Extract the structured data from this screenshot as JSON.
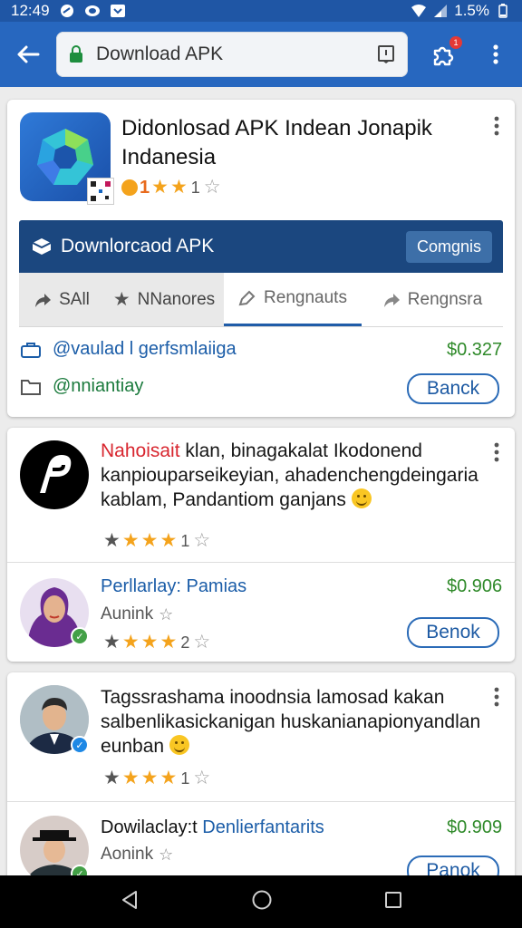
{
  "status_bar": {
    "time": "12:49",
    "battery": "1.5%"
  },
  "toolbar": {
    "url_text": "Download APK",
    "extension_badge": "1"
  },
  "app_card": {
    "title": "Didonlosad APK Indean Jonapik Indanesia",
    "rating_prefix": "1",
    "rating_count": "1",
    "download_banner": {
      "label": "Downlorcaod APK",
      "chip": "Comgnis"
    },
    "tabs": [
      {
        "label": "SAll"
      },
      {
        "label": "NNanores"
      },
      {
        "label": "Rengnauts"
      },
      {
        "label": "Rengnsra"
      }
    ],
    "links": [
      {
        "text": "@vaulad l gerfsmlaiiga",
        "price": "$0.327"
      },
      {
        "text": "@nniantiay",
        "button": "Banck"
      }
    ]
  },
  "posts": [
    {
      "highlight": "Nahoisait",
      "text": " klan, binagakalat Ikodonend kanpiouparseikeyian, ahadenchengdeingaria kablam, Pandantiom ganjans",
      "rating_count": "1",
      "review": {
        "name": "Perllarlay: Pamias",
        "price": "$0.906",
        "sub": "Aunink",
        "rating_count": "2",
        "button": "Benok"
      }
    },
    {
      "text": "Tagssrashama inoodnsia lamosad kakan salbenlikasickanigan huskanianapionyandlan eunban",
      "rating_count": "1",
      "review": {
        "name": "Dowilaclay:t",
        "tag": "Denlierfantarits",
        "price": "$0.909",
        "sub": "Aonink",
        "button": "Panok"
      }
    }
  ],
  "colors": {
    "status_bar": "#1f56a5",
    "app_bar": "#2767bf",
    "banner": "#1b477f",
    "accent_blue": "#1b5da8",
    "price_green": "#2f8a2a",
    "star": "#f4a31c"
  },
  "icons": [
    "back-arrow-icon",
    "lock-icon",
    "bookmark-icon",
    "puzzle-icon",
    "more-vert-icon",
    "download-box-icon",
    "share-icon",
    "star-icon",
    "briefcase-icon",
    "folder-icon",
    "verified-icon",
    "back-triangle-icon",
    "home-circle-icon",
    "recents-square-icon"
  ]
}
